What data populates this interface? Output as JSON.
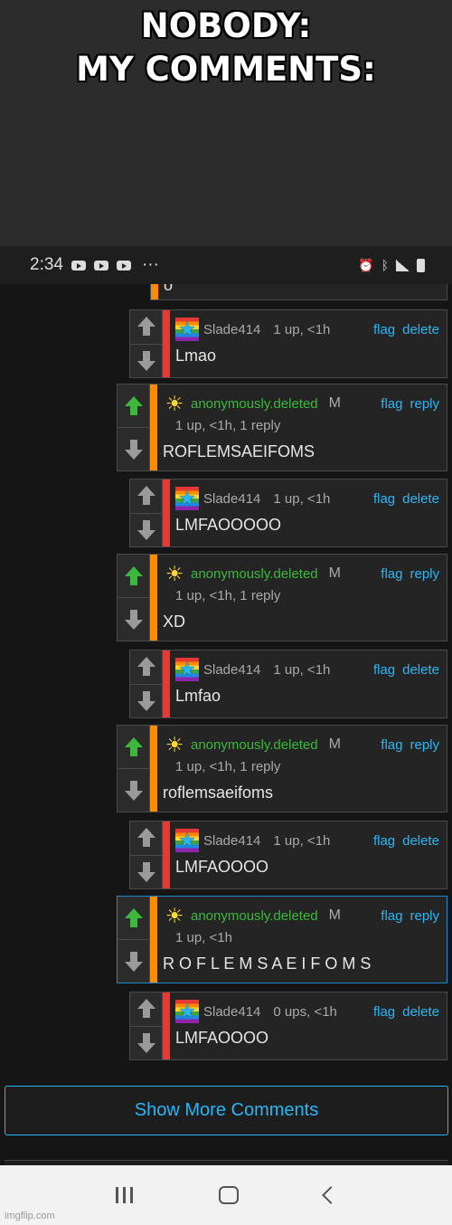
{
  "meme": {
    "line1": "NOBODY:",
    "line2": "MY COMMENTS:"
  },
  "status_bar": {
    "time": "2:34",
    "more": "···",
    "icons": [
      "youtube-icon",
      "youtube-icon",
      "youtube-icon",
      "alarm-icon",
      "bluetooth-icon",
      "signal-icon",
      "battery-icon"
    ]
  },
  "partial_comment_text": "o",
  "actions": {
    "flag": "flag",
    "delete": "delete",
    "reply": "reply"
  },
  "comments": [
    {
      "user": "Slade414",
      "avatar": "rainbow-star-icon",
      "meta": "1 up, <1h",
      "text": "Lmao",
      "own": true
    },
    {
      "user": "anonymously.deleted",
      "avatar": "sun-icon",
      "badge": "M",
      "meta": "1 up, <1h, 1 reply",
      "text": "ROFLEMSAEIFOMS",
      "own": false
    },
    {
      "user": "Slade414",
      "avatar": "rainbow-star-icon",
      "meta": "1 up, <1h",
      "text": "LMFAOOOOO",
      "own": true
    },
    {
      "user": "anonymously.deleted",
      "avatar": "sun-icon",
      "badge": "M",
      "meta": "1 up, <1h, 1 reply",
      "text": "XD",
      "own": false
    },
    {
      "user": "Slade414",
      "avatar": "rainbow-star-icon",
      "meta": "1 up, <1h",
      "text": "Lmfao",
      "own": true
    },
    {
      "user": "anonymously.deleted",
      "avatar": "sun-icon",
      "badge": "M",
      "meta": "1 up, <1h, 1 reply",
      "text": "roflemsaeifoms",
      "own": false
    },
    {
      "user": "Slade414",
      "avatar": "rainbow-star-icon",
      "meta": "1 up, <1h",
      "text": "LMFAOOOO",
      "own": true
    },
    {
      "user": "anonymously.deleted",
      "avatar": "sun-icon",
      "badge": "M",
      "meta": "1 up, <1h",
      "text": "R O F L E M S A E I F O M S",
      "own": false,
      "highlighted": true
    },
    {
      "user": "Slade414",
      "avatar": "rainbow-star-icon",
      "meta": "0 ups, <1h",
      "text": "LMFAOOOO",
      "own": true
    }
  ],
  "show_more_label": "Show More Comments",
  "watermark": "imgflip.com",
  "colors": {
    "own_bar": "#e53935",
    "other_bar": "#fb8c00",
    "link": "#29b6f6",
    "upvoted": "#3cb83c"
  }
}
